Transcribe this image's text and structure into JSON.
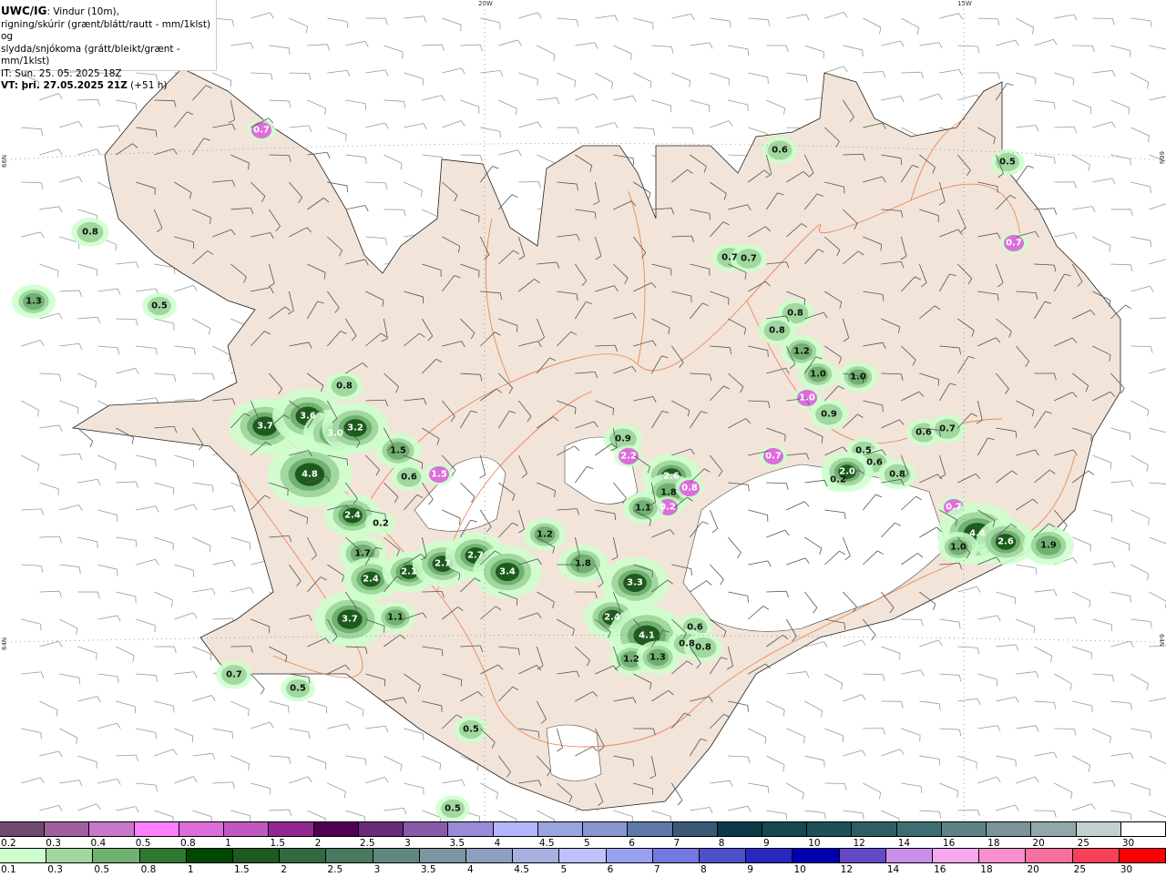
{
  "title": {
    "model": "UWC/IG",
    "line1": ": Vindur (10m),",
    "line2": "rigning/skúrir (grænt/blátt/rautt - mm/1klst) og",
    "line3": "slydda/snjókoma (grátt/bleikt/grænt - mm/1klst)",
    "init": "IT: Sun. 25. 05. 2025 18Z",
    "valid_bold": "VT: þri. 27.05.2025 21Z",
    "valid_offset": " (+51 h)"
  },
  "axes": {
    "lon_20w": "20W",
    "lon_15w": "15W",
    "lat_66n": "66N",
    "lat_64n": "64N"
  },
  "colors": {
    "land": "#f2e4d8",
    "sea": "#ffffff",
    "roads": "#e8703a",
    "glacier": "#ffffff"
  },
  "precip_labels": [
    {
      "v": "0.7",
      "k": "snow"
    },
    {
      "v": "0.8",
      "k": "rain"
    },
    {
      "v": "1.3",
      "k": "rain"
    },
    {
      "v": "0.5",
      "k": "rain"
    },
    {
      "v": "0.8",
      "k": "rain"
    },
    {
      "v": "3.7",
      "k": "rain"
    },
    {
      "v": "3.6",
      "k": "rain"
    },
    {
      "v": "3.0",
      "k": "rain"
    },
    {
      "v": "3.2",
      "k": "rain"
    },
    {
      "v": "1.5",
      "k": "rain"
    },
    {
      "v": "4.8",
      "k": "rain"
    },
    {
      "v": "0.6",
      "k": "rain"
    },
    {
      "v": "1.5",
      "k": "snow"
    },
    {
      "v": "2.4",
      "k": "rain"
    },
    {
      "v": "0.2",
      "k": "rain"
    },
    {
      "v": "1.7",
      "k": "rain"
    },
    {
      "v": "2.4",
      "k": "rain"
    },
    {
      "v": "2.1",
      "k": "rain"
    },
    {
      "v": "2.7",
      "k": "rain"
    },
    {
      "v": "2.7",
      "k": "rain"
    },
    {
      "v": "3.4",
      "k": "rain"
    },
    {
      "v": "3.7",
      "k": "rain"
    },
    {
      "v": "1.1",
      "k": "rain"
    },
    {
      "v": "0.7",
      "k": "rain"
    },
    {
      "v": "0.5",
      "k": "rain"
    },
    {
      "v": "0.5",
      "k": "rain"
    },
    {
      "v": "0.5",
      "k": "rain"
    },
    {
      "v": "0.9",
      "k": "rain"
    },
    {
      "v": "2.2",
      "k": "snow"
    },
    {
      "v": "2.6",
      "k": "rain"
    },
    {
      "v": "1.8",
      "k": "rain"
    },
    {
      "v": "0.8",
      "k": "snow"
    },
    {
      "v": "0.2",
      "k": "snow"
    },
    {
      "v": "1.1",
      "k": "rain"
    },
    {
      "v": "1.2",
      "k": "rain"
    },
    {
      "v": "1.8",
      "k": "rain"
    },
    {
      "v": "3.3",
      "k": "rain"
    },
    {
      "v": "2.4",
      "k": "rain"
    },
    {
      "v": "4.1",
      "k": "rain"
    },
    {
      "v": "1.2",
      "k": "rain"
    },
    {
      "v": "1.3",
      "k": "rain"
    },
    {
      "v": "0.6",
      "k": "rain"
    },
    {
      "v": "0.8",
      "k": "rain"
    },
    {
      "v": "0.8",
      "k": "rain"
    },
    {
      "v": "0.7",
      "k": "snow"
    },
    {
      "v": "0.6",
      "k": "rain"
    },
    {
      "v": "0.7",
      "k": "rain"
    },
    {
      "v": "0.7",
      "k": "rain"
    },
    {
      "v": "0.8",
      "k": "rain"
    },
    {
      "v": "0.8",
      "k": "rain"
    },
    {
      "v": "1.2",
      "k": "rain"
    },
    {
      "v": "1.0",
      "k": "rain"
    },
    {
      "v": "1.0",
      "k": "rain"
    },
    {
      "v": "1.0",
      "k": "snow"
    },
    {
      "v": "0.9",
      "k": "rain"
    },
    {
      "v": "0.6",
      "k": "rain"
    },
    {
      "v": "0.7",
      "k": "rain"
    },
    {
      "v": "0.5",
      "k": "rain"
    },
    {
      "v": "0.6",
      "k": "rain"
    },
    {
      "v": "0.8",
      "k": "rain"
    },
    {
      "v": "0.2",
      "k": "rain"
    },
    {
      "v": "2.0",
      "k": "rain"
    },
    {
      "v": "0.5",
      "k": "rain"
    },
    {
      "v": "0.7",
      "k": "snow"
    },
    {
      "v": "0.7",
      "k": "snow"
    },
    {
      "v": "4.4",
      "k": "rain"
    },
    {
      "v": "2.6",
      "k": "rain"
    },
    {
      "v": "1.9",
      "k": "rain"
    },
    {
      "v": "1.0",
      "k": "rain"
    }
  ],
  "legend_snow": {
    "labels": [
      "0.2",
      "0.3",
      "0.4",
      "0.5",
      "0.8",
      "1",
      "1.5",
      "2",
      "2.5",
      "3",
      "3.5",
      "4",
      "4.5",
      "5",
      "6",
      "7",
      "8",
      "9",
      "10",
      "12",
      "14",
      "16",
      "18",
      "20",
      "25",
      "30"
    ],
    "colors": [
      "#6e4a6e",
      "#a060a0",
      "#c878c8",
      "#ff80ff",
      "#dc6edc",
      "#c058c0",
      "#902890",
      "#500050",
      "#6a2a7a",
      "#8a5aaa",
      "#9a8ad8",
      "#b4b4ff",
      "#9aa4e0",
      "#8a96d0",
      "#5e78a8",
      "#3a5a78",
      "#0a3a48",
      "#164850",
      "#1e5058",
      "#2e5e64",
      "#3e6e72",
      "#5e8286",
      "#7a9498",
      "#90a8aa",
      "#c4d0d0",
      "#ffffff"
    ]
  },
  "legend_rain": {
    "labels": [
      "0.1",
      "0.3",
      "0.5",
      "0.8",
      "1",
      "1.5",
      "2",
      "2.5",
      "3",
      "3.5",
      "4",
      "4.5",
      "5",
      "6",
      "7",
      "8",
      "9",
      "10",
      "12",
      "14",
      "16",
      "18",
      "20",
      "25",
      "30"
    ],
    "colors": [
      "#ccffcc",
      "#a0d8a0",
      "#70b070",
      "#307830",
      "#004800",
      "#1e5a1e",
      "#306a40",
      "#487a60",
      "#5e8880",
      "#7a96a0",
      "#8ea0c0",
      "#a8b0e0",
      "#c0c0ff",
      "#9aa0f0",
      "#7478e0",
      "#5050c8",
      "#2828c0",
      "#0000b0",
      "#6448c8",
      "#c890e8",
      "#f8a8f0",
      "#f890d0",
      "#f870a0",
      "#f84058",
      "#ff0000"
    ]
  }
}
